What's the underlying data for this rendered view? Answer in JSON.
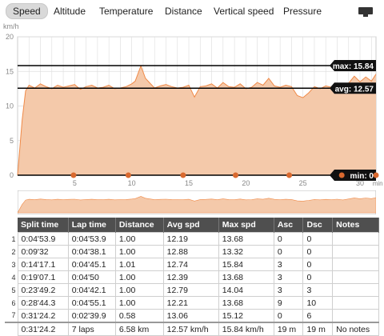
{
  "tabs": [
    {
      "label": "Speed",
      "active": true
    },
    {
      "label": "Altitude"
    },
    {
      "label": "Temperature"
    },
    {
      "label": "Distance"
    },
    {
      "label": "Vertical speed"
    },
    {
      "label": "Pressure"
    }
  ],
  "chart_data": {
    "type": "area",
    "ylabel": "km/h",
    "xlabel": "min",
    "ylim": [
      0,
      20
    ],
    "xlim": [
      0,
      31.4
    ],
    "y_ticks": [
      0,
      5,
      10,
      15,
      20
    ],
    "x_ticks": [
      5,
      10,
      15,
      20,
      25,
      30
    ],
    "grid": true,
    "series": [
      {
        "x": [
          0,
          0.4,
          0.7,
          1.0,
          1.5,
          2,
          2.5,
          3,
          3.5,
          4,
          4.5,
          5,
          5.5,
          6,
          6.5,
          7,
          7.5,
          8,
          8.5,
          9,
          9.5,
          10,
          10.3,
          10.8,
          11.2,
          11.6,
          12,
          12.5,
          13,
          13.5,
          14,
          14.5,
          15,
          15.5,
          16,
          16.5,
          17,
          17.5,
          18,
          18.5,
          19,
          19.5,
          20,
          20.5,
          21,
          21.5,
          22,
          22.5,
          23,
          23.5,
          24,
          24.5,
          25,
          25.5,
          26,
          26.5,
          27,
          27.5,
          28,
          28.5,
          29,
          29.5,
          30,
          30.5,
          31,
          31.4
        ],
        "y": [
          0,
          8,
          12.2,
          13.0,
          12.6,
          13.2,
          12.8,
          12.5,
          13.0,
          12.7,
          12.9,
          13.1,
          12.4,
          12.8,
          13.0,
          12.6,
          12.7,
          13.0,
          12.5,
          12.6,
          12.8,
          13.2,
          13.6,
          15.8,
          14.0,
          13.3,
          12.6,
          12.9,
          13.1,
          12.8,
          12.6,
          12.7,
          13.0,
          11.3,
          12.8,
          12.9,
          13.2,
          12.6,
          13.4,
          12.8,
          12.7,
          13.2,
          12.5,
          12.7,
          13.4,
          13.0,
          14.0,
          12.9,
          12.7,
          13.0,
          12.8,
          11.5,
          11.2,
          11.9,
          12.8,
          12.5,
          12.9,
          12.7,
          13.1,
          12.4,
          13.3,
          14.3,
          13.5,
          14.2,
          13.6,
          14.6
        ]
      }
    ],
    "lines": [
      {
        "label": "max",
        "value": 15.84,
        "text": "max: 15.84"
      },
      {
        "label": "avg",
        "value": 12.57,
        "text": "avg: 12.57"
      },
      {
        "label": "min",
        "value": 0,
        "text": "min: 0"
      }
    ],
    "lap_markers": [
      4.9,
      9.7,
      14.5,
      19.1,
      23.8,
      28.4,
      31.4
    ]
  },
  "table": {
    "columns": [
      "Split time",
      "Lap time",
      "Distance",
      "Avg spd",
      "Max spd",
      "Asc",
      "Dsc",
      "Notes"
    ],
    "rows": [
      [
        "1",
        "0:04'53.9",
        "0:04'53.9",
        "1.00",
        "12.19",
        "13.68",
        "0",
        "0",
        ""
      ],
      [
        "2",
        "0:09'32",
        "0:04'38.1",
        "1.00",
        "12.88",
        "13.32",
        "0",
        "0",
        ""
      ],
      [
        "3",
        "0:14'17.1",
        "0:04'45.1",
        "1.01",
        "12.74",
        "15.84",
        "3",
        "0",
        ""
      ],
      [
        "4",
        "0:19'07.1",
        "0:04'50",
        "1.00",
        "12.39",
        "13.68",
        "3",
        "0",
        ""
      ],
      [
        "5",
        "0:23'49.2",
        "0:04'42.1",
        "1.00",
        "12.79",
        "14.04",
        "3",
        "3",
        ""
      ],
      [
        "6",
        "0:28'44.3",
        "0:04'55.1",
        "1.00",
        "12.21",
        "13.68",
        "9",
        "10",
        ""
      ],
      [
        "7",
        "0:31'24.2",
        "0:02'39.9",
        "0.58",
        "13.06",
        "15.12",
        "0",
        "6",
        ""
      ]
    ],
    "total": [
      "",
      "0:31'24.2",
      "7 laps",
      "6.58 km",
      "12.57 km/h",
      "15.84 km/h",
      "19 m",
      "19 m",
      "No notes"
    ]
  },
  "colors": {
    "area": "#f4c9aa",
    "line": "#f08a48",
    "marker": "#d9692f",
    "grid": "#dddddd"
  }
}
